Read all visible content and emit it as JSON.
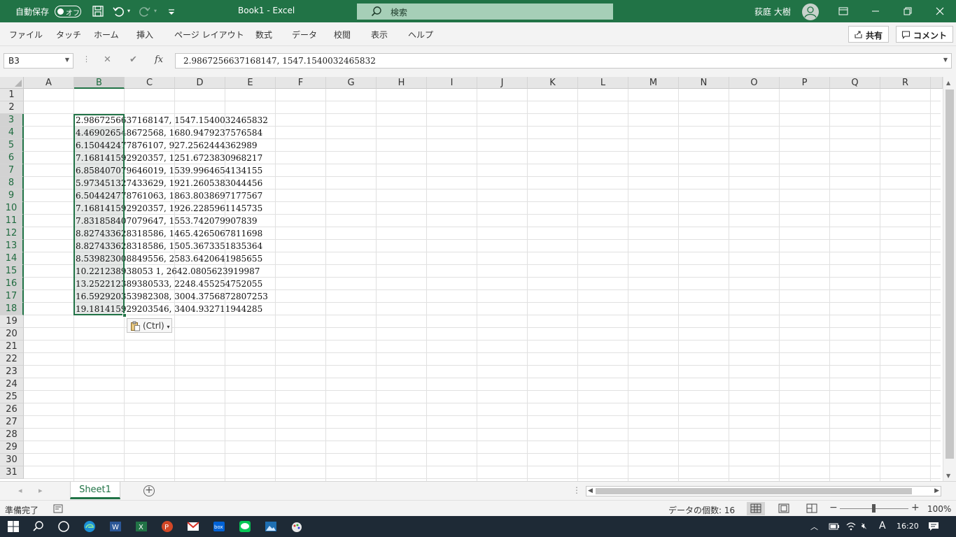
{
  "app": {
    "autosave_label": "自動保存",
    "autosave_state": "オフ",
    "title": "Book1  -  Excel",
    "search_placeholder": "検索",
    "user_name": "荻庭 大樹"
  },
  "menu": {
    "items": [
      "ファイル",
      "タッチ",
      "ホーム",
      "挿入",
      "ページ レイアウト",
      "数式",
      "データ",
      "校閲",
      "表示",
      "ヘルプ"
    ],
    "share_label": "共有",
    "comment_label": "コメント"
  },
  "formula_bar": {
    "name_box": "B3",
    "fx_label": "fx",
    "cancel_label": "✕",
    "enter_label": "✔",
    "value": "2.9867256637168147, 1547.1540032465832"
  },
  "grid": {
    "columns": [
      "A",
      "B",
      "C",
      "D",
      "E",
      "F",
      "G",
      "H",
      "I",
      "J",
      "K",
      "L",
      "M",
      "N",
      "O",
      "P",
      "Q",
      "R"
    ],
    "selected_column": "B",
    "rows": [
      "1",
      "2",
      "3",
      "4",
      "5",
      "6",
      "7",
      "8",
      "9",
      "10",
      "11",
      "12",
      "13",
      "14",
      "15",
      "16",
      "17",
      "18",
      "19",
      "20",
      "21",
      "22",
      "23",
      "24",
      "25",
      "26",
      "27",
      "28",
      "29",
      "30",
      "31"
    ],
    "selected_rows": [
      "3",
      "4",
      "5",
      "6",
      "7",
      "8",
      "9",
      "10",
      "11",
      "12",
      "13",
      "14",
      "15",
      "16",
      "17",
      "18"
    ],
    "cells_B3_B18": [
      "2.9867256637168147, 1547.1540032465832",
      "4.469026548672568, 1680.9479237576584",
      "6.150442477876107, 927.2562444362989",
      "7.168141592920357, 1251.6723830968217",
      "6.858407079646019, 1539.9964654134155",
      "5.973451327433629, 1921.2605383044456",
      "6.504424778761063, 1863.8038697177567",
      "7.168141592920357, 1926.2285961145735",
      "7.831858407079647, 1553.742079907839",
      "8.827433628318586, 1465.4265067811698",
      "8.827433628318586, 1505.3673351835364",
      "8.539823008849556, 2583.6420641985655",
      "10.221238938053 1, 2642.0805623919987",
      "13.252212389380533, 2248.455254752055",
      "16.592920353982308, 3004.3756872807253",
      "19.181415929203546, 3404.932711944285"
    ],
    "paste_options_label": "(Ctrl)"
  },
  "sheets": {
    "tabs": [
      "Sheet1"
    ]
  },
  "status": {
    "ready": "準備完了",
    "count_label": "データの個数: 16",
    "zoom": "100%"
  },
  "taskbar": {
    "time": "16:20",
    "ime": "A"
  },
  "colors": {
    "excel_green": "#217346",
    "taskbar": "#1e2a36"
  }
}
